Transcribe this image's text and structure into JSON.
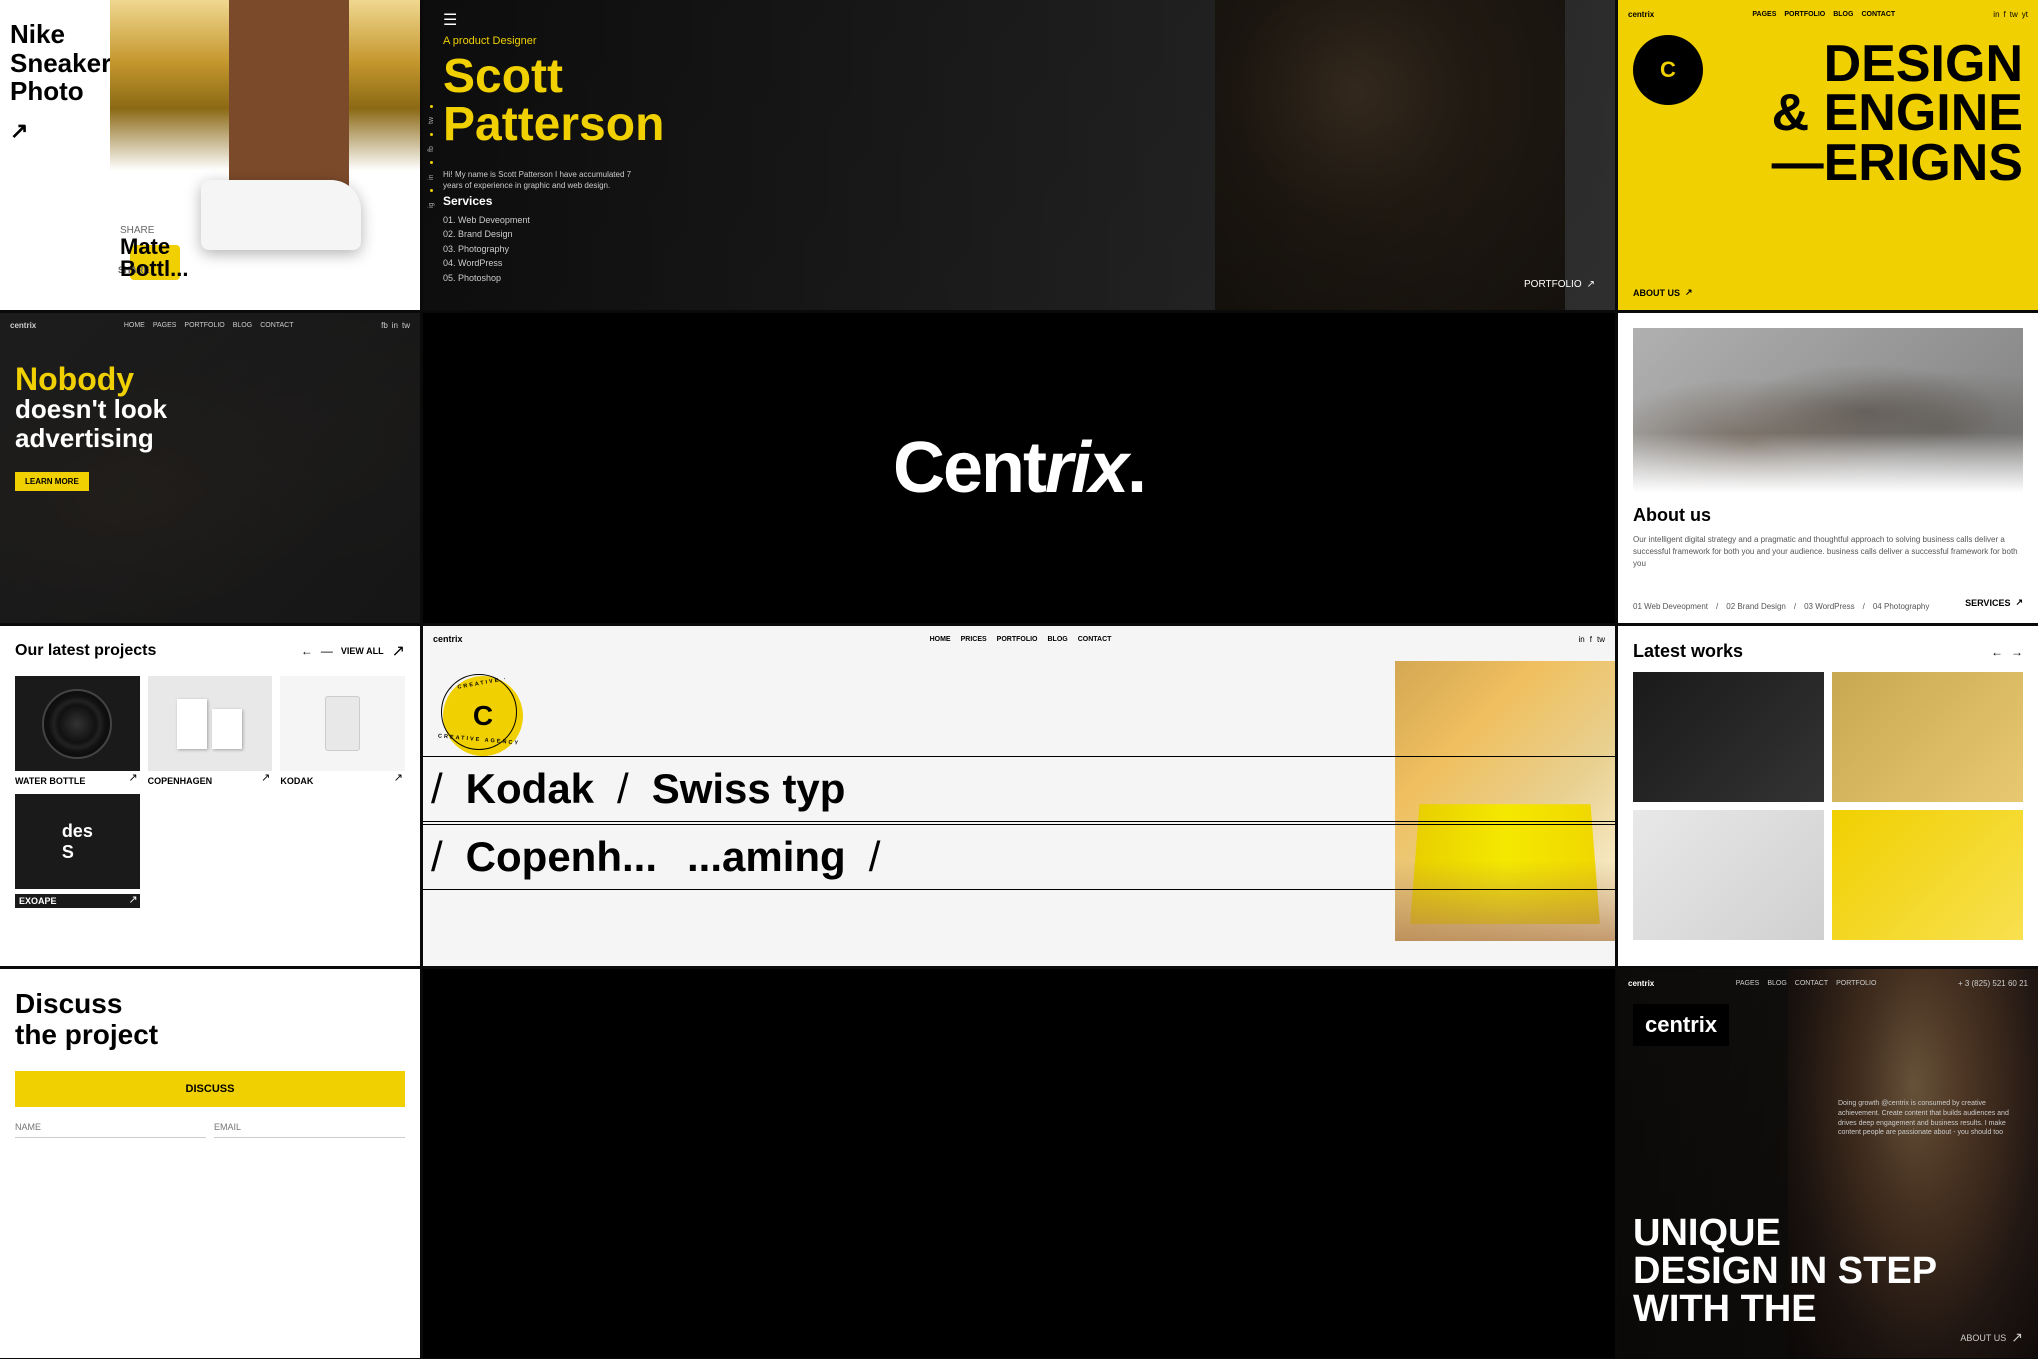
{
  "brand": {
    "name": "Centrix",
    "tagline": "Centrix.",
    "letter": "C"
  },
  "panels": {
    "nike": {
      "title": "Nike Sneakers Photo",
      "arrow": "↗",
      "subtitle": "SHARE",
      "mate_title": "Mate\nBottl..."
    },
    "nobody": {
      "nav_logo": "centrix",
      "nav_links": [
        "HOME",
        "PAGES",
        "PORTFOLIO",
        "BLOG",
        "CONTACT"
      ],
      "heading_yellow": "Nobody",
      "heading_black": "doesn't look\nadvertising",
      "btn_label": "LEARN MORE",
      "social_icons": [
        "fb",
        "in",
        "tw"
      ]
    },
    "projects": {
      "title": "Our latest projects",
      "view_all": "VIEW ALL",
      "arrow": "↗",
      "items": [
        {
          "label": "WATER BOTTLE",
          "type": "vinyl"
        },
        {
          "label": "COPENHAGEN",
          "type": "book"
        },
        {
          "label": "KODAK",
          "type": "kodak"
        },
        {
          "label": "EXOAPE",
          "type": "exape"
        }
      ]
    },
    "discuss": {
      "heading": "Discuss\nthe project",
      "btn_label": "DISCUSS",
      "input1_placeholder": "NAME",
      "input2_placeholder": "EMAIL"
    },
    "scott": {
      "subtitle": "A product Designer",
      "name": "Scott\nPatterson",
      "description": "Hi! My name is Scott Patterson I have accumulated 7 years of experience in graphic and web design.",
      "portfolio_label": "PORTFOLIO",
      "services_title": "Services",
      "services": [
        "01. Web Development",
        "02. Brand Design",
        "03. Photography",
        "04. WordPress",
        "05. Photoshop"
      ],
      "socials": [
        "tw",
        "fb",
        "in",
        "ig"
      ]
    },
    "centrix": {
      "logo": "Centrix."
    },
    "marquee": {
      "nav_logo": "centrix",
      "nav_links": [
        "HOME",
        "PRICES",
        "PORTFOLIO",
        "BLOG",
        "CONTACT"
      ],
      "badge_letter": "C",
      "badge_text": "CREATIVE",
      "line1_slash": "/",
      "line1_text1": "Kodak",
      "line1_slash2": "/",
      "line1_text2": "Swiss typ",
      "line2_slash": "/",
      "line2_text1": "Copenh...",
      "line2_text2": "...aming",
      "line2_slash2": "/"
    },
    "design": {
      "nav_logo": "centrix",
      "nav_links": [
        "PAGES",
        "PORTFOLIO",
        "BLOG",
        "CONTACT"
      ],
      "badge_letter": "C",
      "heading_line1": "DESIGN",
      "heading_line2": "& ENGINE",
      "heading_line3": "—ERIGNS",
      "aboutus": "ABOUT US",
      "aboutus_arrow": "↗"
    },
    "about": {
      "title": "About us",
      "description": "Our intelligent digital strategy and a pragmatic and thoughtful approach to solving business calls deliver a successful framework for both you and your audience. business calls deliver a successful framework for both you",
      "services_label": "SERVICES",
      "services_arrow": "↗",
      "services_list": [
        "01 Web Deveopment",
        "02 Brand Design",
        "03 WordPress",
        "04 Photography"
      ]
    },
    "works": {
      "title": "Latest works",
      "nav_left": "←",
      "nav_right": "→"
    },
    "unique": {
      "nav_logo": "centrix",
      "nav_links": [
        "PAGES",
        "BLOG",
        "CONTACT",
        "PORTFOLIO"
      ],
      "phone": "+ 3 (825) 521 60 21",
      "logo_text": "centrix",
      "heading_line1": "UNIQUE",
      "heading_line2": "DESIGN IN STEP",
      "heading_line3": "WITH THE",
      "aboutus": "ABOUT US",
      "quote": "Doing growth @centrix is consumed by creative achievement. Create content that builds audiences and drives deep engagement and business results. I make content people are passionate about - you should too"
    }
  }
}
